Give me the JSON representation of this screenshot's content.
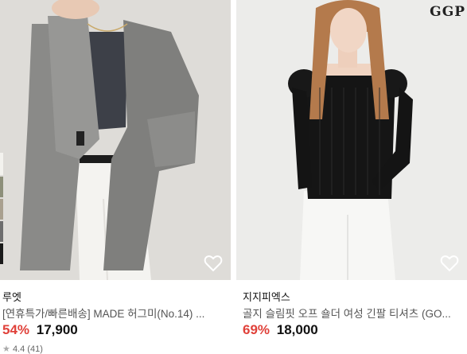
{
  "products": [
    {
      "brand": "루엣",
      "title": "[연휴특가/빠른배송] MADE 허그미(No.14) ...",
      "discount": "54%",
      "price": "17,900",
      "rating": "4.4",
      "reviews": "(41)"
    },
    {
      "brand": "지지피엑스",
      "title": "골지 슬림핏 오프 숄더 여성 긴팔 티셔츠 (GO...",
      "discount": "69%",
      "price": "18,000",
      "logo": "GGP"
    }
  ],
  "colors": {
    "discount": "#e0413a",
    "price": "#111111",
    "muted": "#555555"
  },
  "icons": {
    "wishlist": "heart-outline-icon",
    "rating": "star-icon"
  }
}
